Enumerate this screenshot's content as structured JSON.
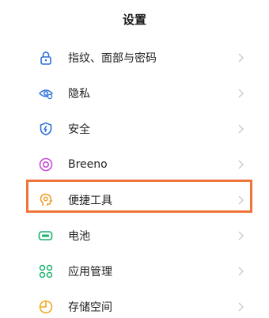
{
  "header": {
    "title": "设置"
  },
  "settings": {
    "items": [
      {
        "label": "指纹、面部与密码",
        "icon": "lock-icon",
        "color": "#2f6fdb"
      },
      {
        "label": "隐私",
        "icon": "privacy-eye-icon",
        "color": "#2f6fdb"
      },
      {
        "label": "安全",
        "icon": "shield-icon",
        "color": "#2f6fdb"
      },
      {
        "label": "Breeno",
        "icon": "breeno-icon",
        "color": "#c64ad8"
      },
      {
        "label": "便捷工具",
        "icon": "convenience-tools-icon",
        "color": "#f09a1f"
      },
      {
        "label": "电池",
        "icon": "battery-icon",
        "color": "#19b36b"
      },
      {
        "label": "应用管理",
        "icon": "app-management-icon",
        "color": "#19b36b"
      },
      {
        "label": "存储空间",
        "icon": "storage-pie-icon",
        "color": "#f0a81f"
      }
    ]
  },
  "annotation": {
    "highlight_color": "#f0743a"
  }
}
